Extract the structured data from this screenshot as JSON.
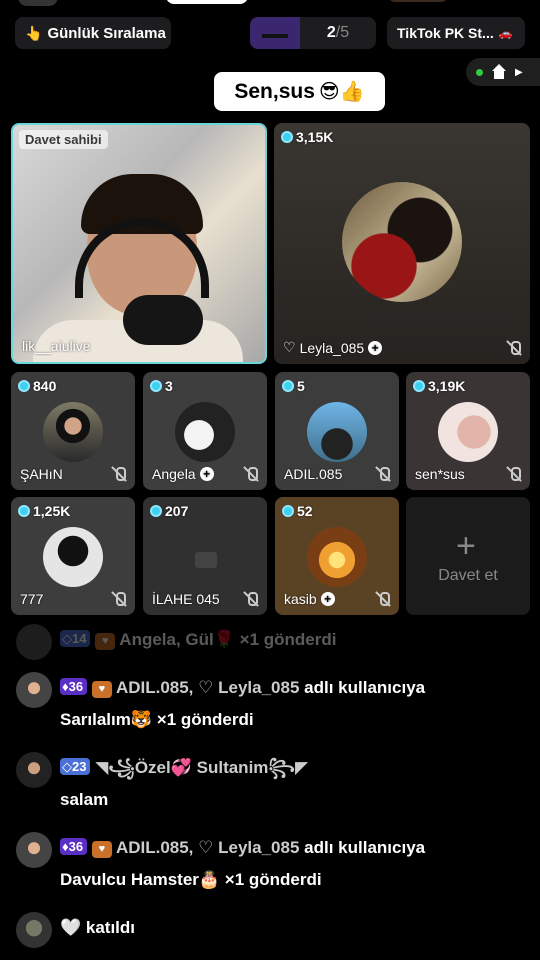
{
  "top_bar": {
    "ranking_label": "Günlük Sıralama",
    "ranking_icon": "👆",
    "pk_current": "2",
    "pk_total": "/5",
    "pk_icon": "sunglasses-icon",
    "stream_label": "TikTok PK St...",
    "stream_icon": "sticker-icon"
  },
  "room_title": "Sen,sus",
  "room_title_emoji": "😎👍",
  "colors": {
    "accent_teal": "#6ad6d9",
    "gem": "#3fd0f0",
    "level_purple": "#5a2fc4",
    "level_blue": "#4a6fd6"
  },
  "host": {
    "badge": "Davet sahibi",
    "name": "lik__aiulive"
  },
  "guests": [
    {
      "count": "3,15K",
      "name": "Leyla_085",
      "prefix": "♡",
      "plus": true,
      "muted": true
    },
    {
      "count": "840",
      "name": "ŞAHıN",
      "plus": false,
      "muted": true
    },
    {
      "count": "3",
      "name": "Angela",
      "plus": true,
      "muted": true
    },
    {
      "count": "5",
      "name": "ADIL.085",
      "plus": false,
      "muted": true
    },
    {
      "count": "3,19K",
      "name": "sen*sus",
      "plus": false,
      "muted": true
    },
    {
      "count": "1,25K",
      "name": "777",
      "plus": false,
      "muted": true
    },
    {
      "count": "207",
      "name": "İLAHE 045",
      "plus": false,
      "muted": true
    },
    {
      "count": "52",
      "name": "kasib",
      "plus": true,
      "muted": true
    }
  ],
  "invite_label": "Davet et",
  "chat": [
    {
      "level": "14",
      "text": "Angela, Gül🌹 ×1 gönderdi"
    },
    {
      "level": "36",
      "user": "ADIL.085,",
      "target": "♡ Leyla_085",
      "text1": "adlı kullanıcıya",
      "text2": "Sarılalım🐯 ×1 gönderdi"
    },
    {
      "level": "23",
      "user": "◥꧁Özel💞 Sultanim꧂◤",
      "text": "salam"
    },
    {
      "level": "36",
      "user": "ADIL.085,",
      "target": "♡ Leyla_085",
      "text1": "adlı kullanıcıya",
      "text2": "Davulcu Hamster🎂 ×1 gönderdi"
    },
    {
      "text": "🤍 katıldı"
    }
  ]
}
